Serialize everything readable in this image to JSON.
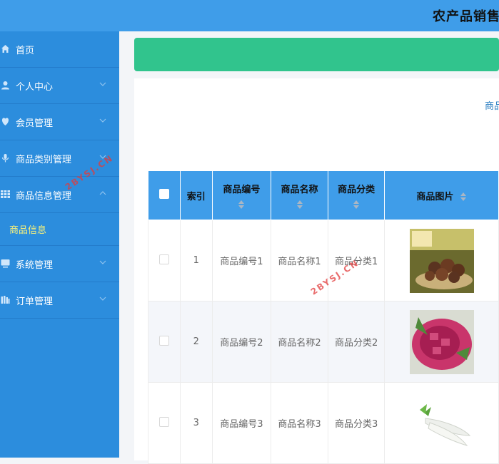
{
  "header": {
    "title": "农产品销售"
  },
  "sidebar": {
    "items": [
      {
        "label": "首页",
        "icon": "home-icon"
      },
      {
        "label": "个人中心",
        "icon": "user-icon"
      },
      {
        "label": "会员管理",
        "icon": "member-icon"
      },
      {
        "label": "商品类别管理",
        "icon": "category-icon"
      },
      {
        "label": "商品信息管理",
        "icon": "grid-icon"
      },
      {
        "label": "系统管理",
        "icon": "monitor-icon"
      },
      {
        "label": "订单管理",
        "icon": "order-icon"
      }
    ],
    "sub_item": {
      "label": "商品信息"
    }
  },
  "breadcrumb": {
    "text": "商品"
  },
  "table": {
    "headers": [
      "索引",
      "商品编号",
      "商品名称",
      "商品分类",
      "商品图片"
    ],
    "rows": [
      {
        "index": "1",
        "code": "商品编号1",
        "name": "商品名称1",
        "category": "商品分类1",
        "image": "dried-mushroom-photo"
      },
      {
        "index": "2",
        "code": "商品编号2",
        "name": "商品名称2",
        "category": "商品分类2",
        "image": "dragon-fruit-photo"
      },
      {
        "index": "3",
        "code": "商品编号3",
        "name": "商品名称3",
        "category": "商品分类3",
        "image": "white-radish-photo"
      }
    ]
  },
  "watermark": {
    "text": "2BYSJ.CN"
  },
  "colors": {
    "topbar": "#3f9de9",
    "sidebar": "#2c8ddd",
    "active_sub": "#f7f17b",
    "accent_green": "#31c48d",
    "table_header": "#3f9de9"
  }
}
